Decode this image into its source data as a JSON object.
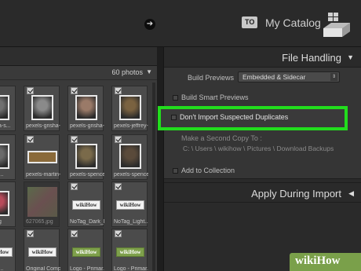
{
  "topbar": {
    "to_badge": "TO",
    "catalog": "My Catalog"
  },
  "grid": {
    "photo_count": "60 photos",
    "rows": [
      [
        {
          "caption": "...rigsha-s...",
          "kind": "portrait",
          "color": "#707070",
          "dim": false
        },
        {
          "caption": "pexels-grisha-s...",
          "kind": "portrait",
          "color": "#8a8a8a",
          "dim": false
        },
        {
          "caption": "pexels-grisha-s...",
          "kind": "portrait",
          "color": "#9a7a68",
          "dim": false
        },
        {
          "caption": "pexels-jeffrey-r...",
          "kind": "portrait",
          "color": "#7a6240",
          "dim": false
        }
      ],
      [
        {
          "caption": "...artin-...",
          "kind": "portrait",
          "color": "#6a6a6a",
          "dim": false
        },
        {
          "caption": "pexels-martin-...",
          "kind": "wide",
          "color": "#8a6a3a",
          "dim": false
        },
        {
          "caption": "pexels-spencer...",
          "kind": "portrait",
          "color": "#7a6a4a",
          "dim": false
        },
        {
          "caption": "pexels-spencer...",
          "kind": "portrait",
          "color": "#5a4a3a",
          "dim": false
        }
      ],
      [
        {
          "caption": "...49.jpg",
          "kind": "portrait",
          "color": "#b84a5a",
          "dim": false
        },
        {
          "caption": "627065.jpg",
          "kind": "blank",
          "color": "#5a5a4a",
          "dim": true
        },
        {
          "caption": "NoTag_Dark_P...",
          "kind": "wikihow",
          "color": "",
          "dim": false
        },
        {
          "caption": "NoTag_Light...",
          "kind": "wikihow",
          "color": "",
          "dim": false
        }
      ],
      [
        {
          "caption": "...Logo...",
          "kind": "wikihow",
          "color": "",
          "dim": false
        },
        {
          "caption": "Original Comp...",
          "kind": "wikihow",
          "color": "",
          "dim": false
        },
        {
          "caption": "Logo - Primar...",
          "kind": "wikihow-green",
          "color": "",
          "dim": false
        },
        {
          "caption": "Logo - Primar...",
          "kind": "wikihow-green",
          "color": "",
          "dim": false
        }
      ]
    ],
    "wikihow_label": "wikiHow"
  },
  "file_handling": {
    "title": "File Handling",
    "build_previews_label": "Build Previews",
    "build_previews_value": "Embedded & Sidecar",
    "smart_previews": "Build Smart Previews",
    "dont_import_duplicates": "Don't Import Suspected Duplicates",
    "second_copy": "Make a Second Copy To :",
    "copy_path": "C: \\ Users \\ wikihow \\ Pictures \\ Download Backups",
    "add_to_collection": "Add to Collection"
  },
  "apply_import": {
    "title": "Apply During Import"
  },
  "watermark": "wikiHow",
  "colors": {
    "highlight": "#22dd1d",
    "accent_green": "#7aa04a"
  }
}
